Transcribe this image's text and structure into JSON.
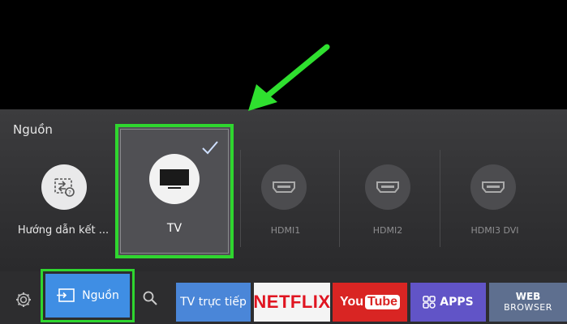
{
  "panel": {
    "title": "Nguồn"
  },
  "sources": [
    {
      "label": "Hướng dẫn kết ...",
      "icon": "connection-guide-icon"
    },
    {
      "label": "TV",
      "icon": "tv-icon",
      "selected": true
    },
    {
      "label": "HDMI1",
      "icon": "hdmi-icon"
    },
    {
      "label": "HDMI2",
      "icon": "hdmi-icon"
    },
    {
      "label": "HDMI3 DVI",
      "icon": "hdmi-icon"
    }
  ],
  "bottom_bar": {
    "settings_icon": "gear-icon",
    "source_button_label": "Nguồn",
    "search_icon": "search-icon",
    "apps": [
      {
        "label": "TV trực tiếp"
      },
      {
        "label": "NETFLIX"
      },
      {
        "label_you": "You",
        "label_tube": "Tube"
      },
      {
        "label": "APPS"
      },
      {
        "label_line1": "WEB",
        "label_line2": "BROWSER"
      }
    ]
  },
  "colors": {
    "highlight": "#2fd62f",
    "source_button": "#3f8ee4",
    "livetv": "#4a86d8",
    "netflix_red": "#e01420",
    "youtube_red": "#d92523",
    "apps_purple": "#6154c7",
    "web_blue": "#5e6f8f"
  }
}
